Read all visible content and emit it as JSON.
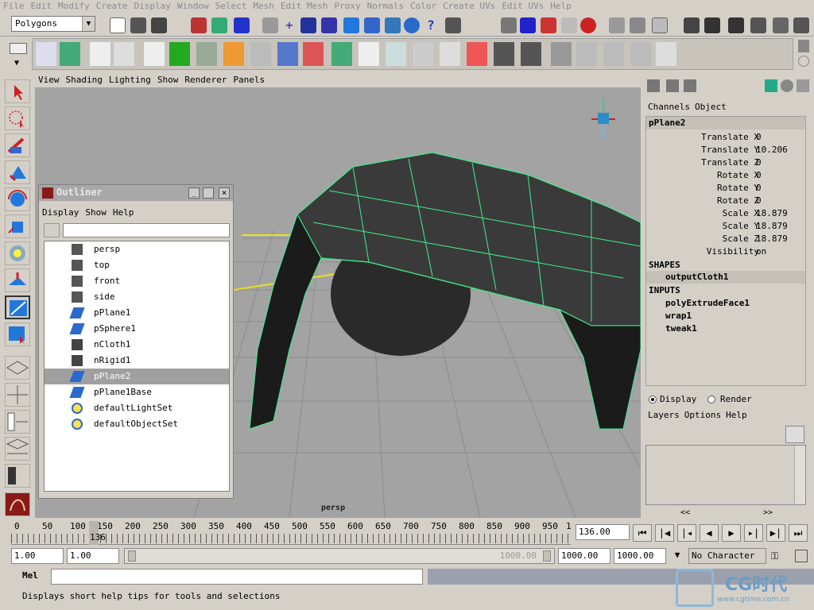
{
  "menu": [
    "File",
    "Edit",
    "Modify",
    "Create",
    "Display",
    "Window",
    "Select",
    "Mesh",
    "Edit Mesh",
    "Proxy",
    "Normals",
    "Color",
    "Create UVs",
    "Edit UVs",
    "Help"
  ],
  "mode_select": "Polygons",
  "panel_menu": [
    "View",
    "Shading",
    "Lighting",
    "Show",
    "Renderer",
    "Panels"
  ],
  "viewport": {
    "camera_label": "persp"
  },
  "outliner": {
    "title": "Outliner",
    "menu": [
      "Display",
      "Show",
      "Help"
    ],
    "items": [
      {
        "label": "persp",
        "icon": "camera-icon"
      },
      {
        "label": "top",
        "icon": "camera-icon"
      },
      {
        "label": "front",
        "icon": "camera-icon"
      },
      {
        "label": "side",
        "icon": "camera-icon"
      },
      {
        "label": "pPlane1",
        "icon": "mesh-icon"
      },
      {
        "label": "pSphere1",
        "icon": "mesh-icon"
      },
      {
        "label": "nCloth1",
        "icon": "cloth-icon"
      },
      {
        "label": "nRigid1",
        "icon": "cloth-icon"
      },
      {
        "label": "pPlane2",
        "icon": "mesh-icon",
        "selected": true
      },
      {
        "label": "pPlane1Base",
        "icon": "mesh-icon"
      },
      {
        "label": "defaultLightSet",
        "icon": "set-icon"
      },
      {
        "label": "defaultObjectSet",
        "icon": "set-icon"
      }
    ]
  },
  "channel_box": {
    "menu": [
      "Channels",
      "Object"
    ],
    "object_name": "pPlane2",
    "attributes": [
      {
        "name": "Translate X",
        "value": "0"
      },
      {
        "name": "Translate Y",
        "value": "10.206"
      },
      {
        "name": "Translate Z",
        "value": "0"
      },
      {
        "name": "Rotate X",
        "value": "0"
      },
      {
        "name": "Rotate Y",
        "value": "0"
      },
      {
        "name": "Rotate Z",
        "value": "0"
      },
      {
        "name": "Scale X",
        "value": "18.879"
      },
      {
        "name": "Scale Y",
        "value": "18.879"
      },
      {
        "name": "Scale Z",
        "value": "18.879"
      },
      {
        "name": "Visibility",
        "value": "on"
      }
    ],
    "shapes_header": "SHAPES",
    "shapes": [
      "outputCloth1"
    ],
    "inputs_header": "INPUTS",
    "inputs": [
      "polyExtrudeFace1",
      "wrap1",
      "tweak1"
    ]
  },
  "layer_editor": {
    "radio_display": "Display",
    "radio_render": "Render",
    "menu": [
      "Layers",
      "Options",
      "Help"
    ],
    "scroll_left": "<<",
    "scroll_right": ">>"
  },
  "timeline": {
    "ticks": [
      "0",
      "50",
      "100",
      "150",
      "200",
      "250",
      "300",
      "350",
      "400",
      "450",
      "500",
      "550",
      "600",
      "650",
      "700",
      "750",
      "800",
      "850",
      "900",
      "950",
      "1"
    ],
    "current_frame_marker": "136",
    "current_frame": "136.00"
  },
  "range": {
    "start": "1.00",
    "playback_start": "1.00",
    "slider_end_label": "1000.00",
    "playback_end": "1000.00",
    "end": "1000.00",
    "character_set": "No Character Set"
  },
  "command_line": {
    "label": "Mel"
  },
  "help_line": "Displays short help tips for tools and selections",
  "watermark": {
    "brand": "CG时代",
    "url": "www.cgtime.com.cn"
  }
}
